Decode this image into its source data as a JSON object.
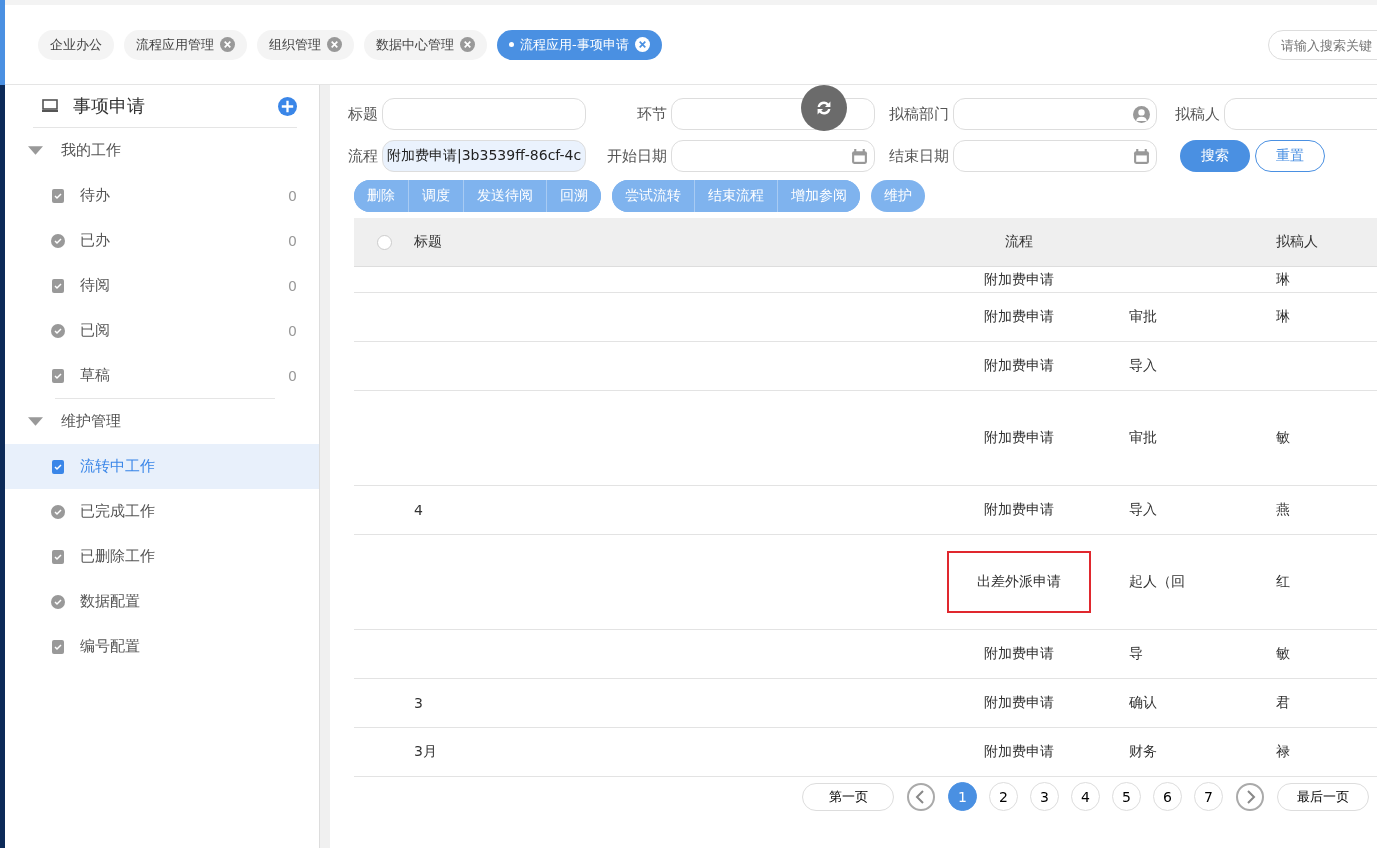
{
  "tabs": [
    {
      "label": "企业办公",
      "closable": false,
      "selected": false
    },
    {
      "label": "流程应用管理",
      "closable": true,
      "selected": false
    },
    {
      "label": "组织管理",
      "closable": true,
      "selected": false
    },
    {
      "label": "数据中心管理",
      "closable": true,
      "selected": false
    },
    {
      "label": "流程应用-事项申请",
      "closable": true,
      "selected": true
    }
  ],
  "top_search": {
    "placeholder": "请输入搜索关键"
  },
  "sidebar": {
    "title": "事项申请",
    "groups": [
      {
        "label": "我的工作",
        "expanded": true,
        "items": [
          {
            "label": "待办",
            "count": "0",
            "selected": false
          },
          {
            "label": "已办",
            "count": "0",
            "selected": false
          },
          {
            "label": "待阅",
            "count": "0",
            "selected": false
          },
          {
            "label": "已阅",
            "count": "0",
            "selected": false
          },
          {
            "label": "草稿",
            "count": "0",
            "selected": false
          }
        ]
      },
      {
        "label": "维护管理",
        "expanded": true,
        "items": [
          {
            "label": "流转中工作",
            "selected": true
          },
          {
            "label": "已完成工作",
            "selected": false
          },
          {
            "label": "已删除工作",
            "selected": false
          },
          {
            "label": "数据配置",
            "selected": false
          },
          {
            "label": "编号配置",
            "selected": false
          }
        ]
      }
    ]
  },
  "filters": [
    {
      "label": "标题",
      "kind": "text"
    },
    {
      "label": "环节",
      "kind": "text"
    },
    {
      "label": "拟稿部门",
      "kind": "person"
    },
    {
      "label": "拟稿人",
      "kind": "text"
    },
    {
      "label": "流程",
      "kind": "text",
      "value": "附加费申请|3b3539ff-86cf-4c"
    },
    {
      "label": "开始日期",
      "kind": "date"
    },
    {
      "label": "结束日期",
      "kind": "date"
    }
  ],
  "search_button": "搜索",
  "reset_button": "重置",
  "action_groups": [
    [
      "删除",
      "调度",
      "发送待阅",
      "回溯"
    ],
    [
      "尝试流转",
      "结束流程",
      "增加参阅"
    ],
    [
      "维护"
    ]
  ],
  "table": {
    "all_selected": false,
    "columns": {
      "title": "标题",
      "flow": "流程",
      "drafter": "拟稿人"
    },
    "rows": [
      {
        "flow": "附加费申请",
        "drafter": "琳"
      },
      {
        "flow": "附加费申请",
        "column_3": "审批",
        "drafter": "琳"
      },
      {
        "flow": "附加费申请",
        "column_3": "导入"
      },
      {
        "flow": "附加费申请",
        "column_3": "审批",
        "drafter": "敏"
      },
      {
        "title": "4",
        "flow": "附加费申请",
        "column_3": "导入",
        "drafter": "燕"
      },
      {
        "flow": "出差外派申请",
        "flow_marked": true,
        "column_3": "起人（回",
        "drafter": "红"
      },
      {
        "flow": "附加费申请",
        "column_3": "导",
        "drafter": "敏"
      },
      {
        "title": "3",
        "flow": "附加费申请",
        "column_3": "确认",
        "drafter": "君"
      },
      {
        "title": "3月",
        "flow": "附加费申请",
        "column_3": "财务",
        "drafter": "禄"
      }
    ]
  },
  "pagination": {
    "first": "第一页",
    "last": "最后一页",
    "pages": [
      {
        "label": "1",
        "selected": true
      },
      {
        "label": "2",
        "selected": false
      },
      {
        "label": "3",
        "selected": false
      },
      {
        "label": "4",
        "selected": false
      },
      {
        "label": "5",
        "selected": false
      },
      {
        "label": "6",
        "selected": false
      },
      {
        "label": "7",
        "selected": false
      }
    ]
  }
}
